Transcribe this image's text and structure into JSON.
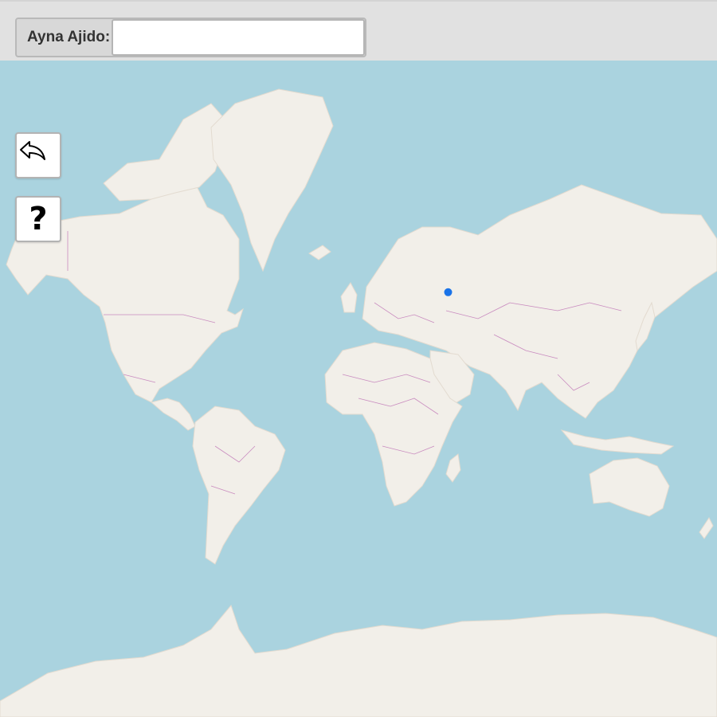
{
  "search": {
    "label": "Ayna Ajido:",
    "value": "",
    "placeholder": ""
  },
  "controls": {
    "back_icon": "reply-arrow-icon",
    "help_label": "?"
  },
  "map": {
    "marker": {
      "lat": 24.5,
      "lon": 45.0,
      "color": "#1a73e8"
    },
    "colors": {
      "water": "#aad3df",
      "land": "#f2efe9",
      "borders": "#c98bbf"
    }
  }
}
